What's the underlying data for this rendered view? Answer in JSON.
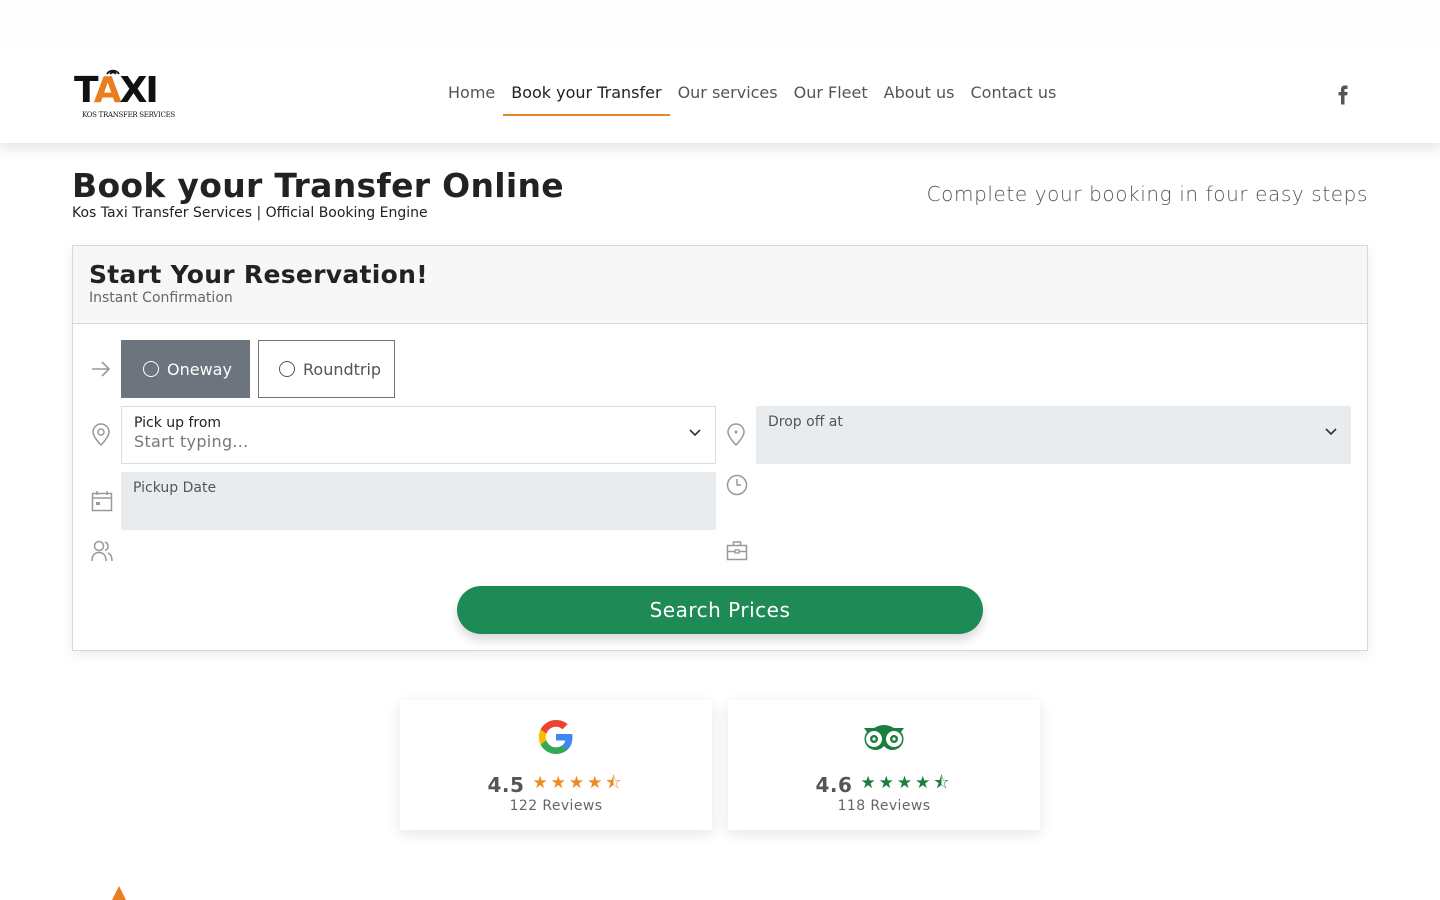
{
  "logo": {
    "text_prefix": "T",
    "text_a": "A",
    "text_suffix": "XI",
    "subtitle": "KOS TRANSFER SERVICES",
    "accent_color": "#ea7d1e"
  },
  "nav": {
    "items": [
      {
        "label": "Home",
        "active": false
      },
      {
        "label": "Book your Transfer",
        "active": true
      },
      {
        "label": "Our services",
        "active": false
      },
      {
        "label": "Our Fleet",
        "active": false
      },
      {
        "label": "About us",
        "active": false
      },
      {
        "label": "Contact us",
        "active": false
      }
    ],
    "social_icon": "facebook-icon"
  },
  "hero": {
    "title": "Book your Transfer Online",
    "subtitle": "Kos Taxi Transfer Services | Official Booking Engine",
    "tagline": "Complete your booking in four easy steps"
  },
  "reservation": {
    "title": "Start Your Reservation!",
    "subtitle": "Instant Confirmation",
    "trip_types": {
      "oneway": "Oneway",
      "roundtrip": "Roundtrip",
      "selected": "oneway"
    },
    "pickup": {
      "label": "Pick up from",
      "placeholder": "Start typing..."
    },
    "dropoff": {
      "label": "Drop off at",
      "placeholder": ""
    },
    "pickup_date": {
      "label": "Pickup Date",
      "value": ""
    },
    "search_button": "Search Prices",
    "button_color": "#1e8a55"
  },
  "reviews": [
    {
      "source": "google-logo-icon",
      "score": "4.5",
      "rating": 4.5,
      "count_text": "122 Reviews",
      "star_color": "#f08a24"
    },
    {
      "source": "tripadvisor-logo-icon",
      "score": "4.6",
      "rating": 4.6,
      "count_text": "118 Reviews",
      "star_color": "#1a7f3c"
    }
  ]
}
